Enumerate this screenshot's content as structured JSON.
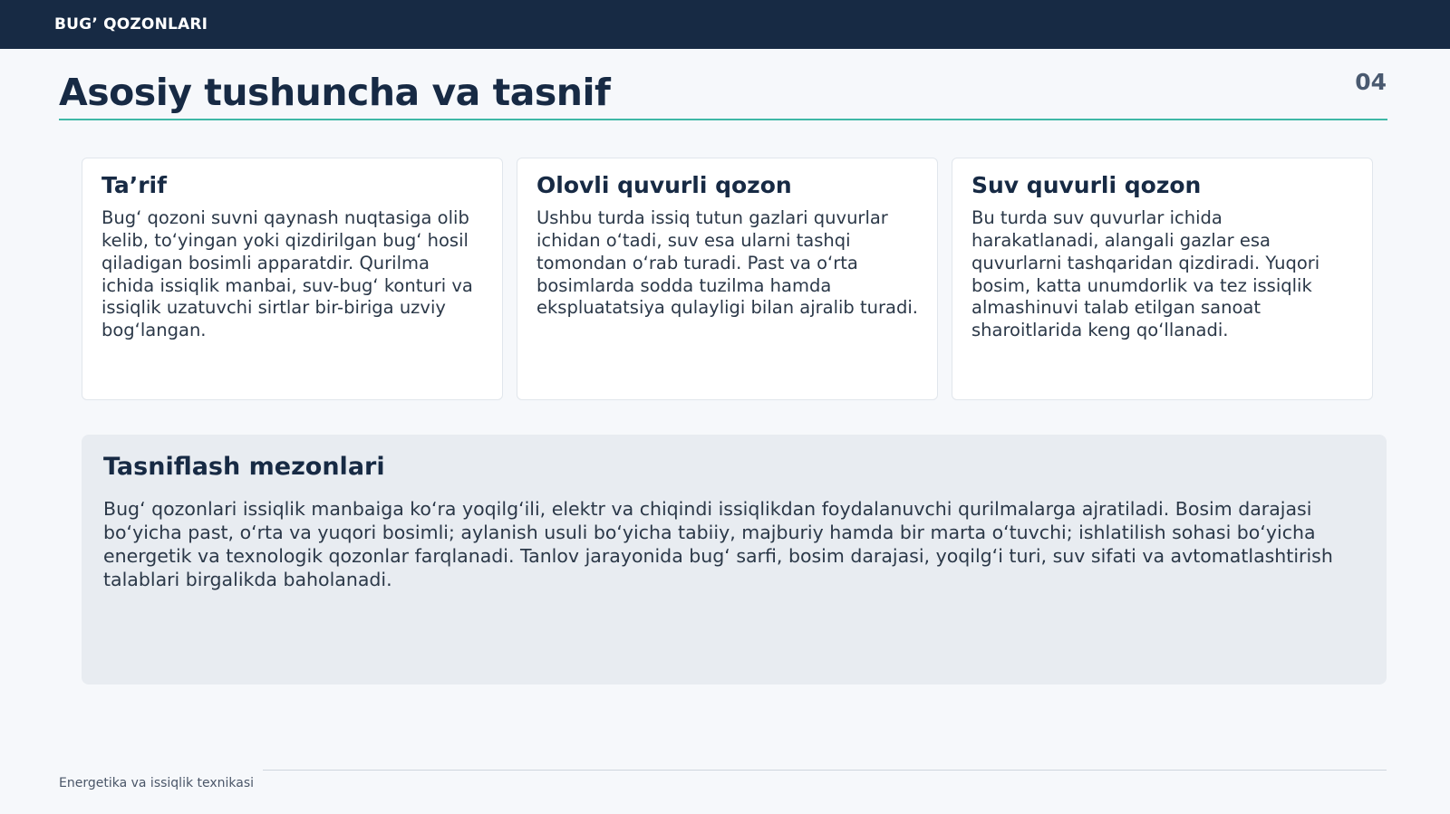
{
  "header": {
    "label": "BUG’ QOZONLARI"
  },
  "page": {
    "title": "Asosiy tushuncha va tasnif",
    "number": "04"
  },
  "cards": [
    {
      "title": "Ta’rif",
      "text": "Bug‘ qozoni suvni qaynash nuqtasiga olib kelib, to‘yingan yoki qizdirilgan bug‘ hosil qiladigan bosimli apparatdir. Qurilma ichida issiqlik manbai, suv-bug‘ konturi va issiqlik uzatuvchi sirtlar bir-biriga uzviy bog‘langan."
    },
    {
      "title": "Olovli quvurli qozon",
      "text": "Ushbu turda issiq tutun gazlari quvurlar ichidan o‘tadi, suv esa ularni tashqi tomondan o‘rab turadi. Past va o‘rta bosimlarda sodda tuzilma hamda ekspluatatsiya qulayligi bilan ajralib turadi."
    },
    {
      "title": "Suv quvurli qozon",
      "text": "Bu turda suv quvurlar ichida harakatlanadi, alangali gazlar esa quvurlarni tashqaridan qizdiradi. Yuqori bosim, katta unumdorlik va tez issiqlik almashinuvi talab etilgan sanoat sharoitlarida keng qo‘llanadi."
    }
  ],
  "criteria": {
    "title": "Tasniflash mezonlari",
    "text": "Bug‘ qozonlari issiqlik manbaiga ko‘ra yoqilg‘ili, elektr va chiqindi issiqlikdan foydalanuvchi qurilmalarga ajratiladi. Bosim darajasi bo‘yicha past, o‘rta va yuqori bosimli; aylanish usuli bo‘yicha tabiiy, majburiy hamda bir marta o‘tuvchi; ishlatilish sohasi bo‘yicha energetik va texnologik qozonlar farqlanadi. Tanlov jarayonida bug‘ sarfi, bosim darajasi, yoqilg‘i turi, suv sifati va avtomatlashtirish talablari birgalikda baholanadi."
  },
  "footer": {
    "text": "Energetika va issiqlik texnikasi"
  },
  "colors": {
    "header_bg": "#172a44",
    "accent": "#3fb8a6",
    "page_bg": "#f6f8fb",
    "panel_bg": "#e8ecf1"
  }
}
